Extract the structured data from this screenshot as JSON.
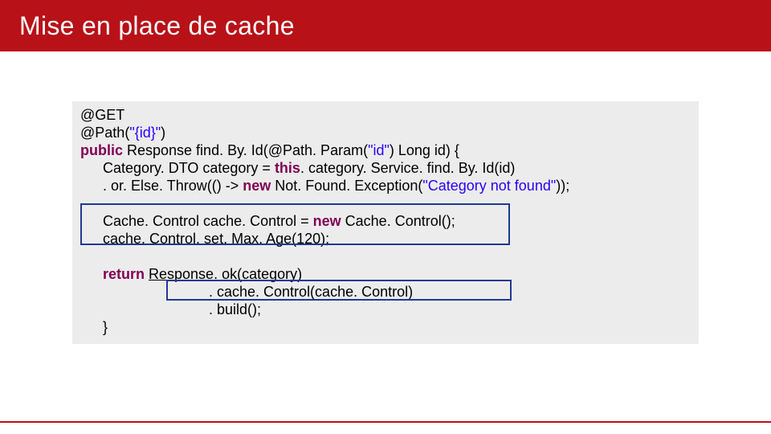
{
  "slide": {
    "title": "Mise en place de cache"
  },
  "code": {
    "l1a": "@GET",
    "l2a": "@Path",
    "l2b": "(",
    "l2c": "\"{id}\"",
    "l2d": ")",
    "l3a": "public ",
    "l3b": "Response find. By. Id(@Path. Param(",
    "l3c": "\"id\"",
    "l3d": ") Long id) {",
    "l4a": "Category. DTO category = ",
    "l4b": "this",
    "l4c": ". category. Service. find. By. Id(id)",
    "l5a": ". or. Else. Throw(() -> ",
    "l5b": "new ",
    "l5c": "Not. Found. Exception(",
    "l5d": "\"Category not found\"",
    "l5e": "));",
    "l6a": "Cache. Control cache. Control = ",
    "l6b": "new ",
    "l6c": "Cache. Control();",
    "l7a": "cache. Control. set. Max. Age(",
    "l7b": "120",
    "l7c": ");",
    "l8a": "return ",
    "l8b": "Response. ok(category)",
    "l9a": ". cache. Control(cache. Control)",
    "l10a": ". build();",
    "l11a": "}"
  }
}
